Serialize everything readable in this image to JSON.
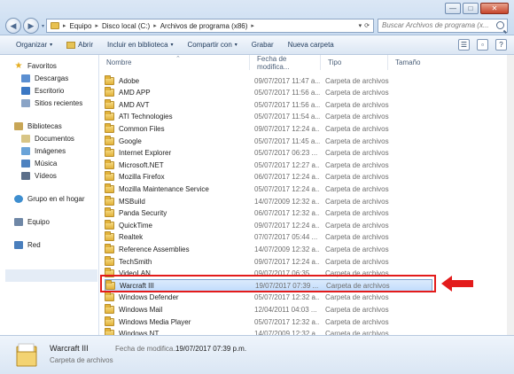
{
  "window": {
    "minimize_glyph": "—",
    "maximize_glyph": "□",
    "close_glyph": "✕"
  },
  "address": {
    "crumbs": [
      "Equipo",
      "Disco local (C:)",
      "Archivos de programa (x86)"
    ],
    "separator": "▸",
    "dropdown_glyph": "▾",
    "refresh_glyph": "⟳"
  },
  "search": {
    "placeholder": "Buscar Archivos de programa (x..."
  },
  "toolbar": {
    "organize": "Organizar",
    "open": "Abrir",
    "include": "Incluir en biblioteca",
    "share": "Compartir con",
    "burn": "Grabar",
    "new_folder": "Nueva carpeta",
    "caret": "▾"
  },
  "navpane": {
    "favorites": "Favoritos",
    "downloads": "Descargas",
    "desktop": "Escritorio",
    "recent": "Sitios recientes",
    "libraries": "Bibliotecas",
    "documents": "Documentos",
    "images": "Imágenes",
    "music": "Música",
    "videos": "Vídeos",
    "homegroup": "Grupo en el hogar",
    "computer": "Equipo",
    "network": "Red"
  },
  "columns": {
    "name": "Nombre",
    "date": "Fecha de modifica...",
    "type": "Tipo",
    "size": "Tamaño"
  },
  "files": [
    {
      "name": "Adobe",
      "date": "09/07/2017 11:47 a...",
      "type": "Carpeta de archivos"
    },
    {
      "name": "AMD APP",
      "date": "05/07/2017 11:56 a...",
      "type": "Carpeta de archivos"
    },
    {
      "name": "AMD AVT",
      "date": "05/07/2017 11:56 a...",
      "type": "Carpeta de archivos"
    },
    {
      "name": "ATI Technologies",
      "date": "05/07/2017 11:54 a...",
      "type": "Carpeta de archivos"
    },
    {
      "name": "Common Files",
      "date": "09/07/2017 12:24 a...",
      "type": "Carpeta de archivos"
    },
    {
      "name": "Google",
      "date": "05/07/2017 11:45 a...",
      "type": "Carpeta de archivos"
    },
    {
      "name": "Internet Explorer",
      "date": "05/07/2017 06:23 ...",
      "type": "Carpeta de archivos"
    },
    {
      "name": "Microsoft.NET",
      "date": "05/07/2017 12:27 a...",
      "type": "Carpeta de archivos"
    },
    {
      "name": "Mozilla Firefox",
      "date": "06/07/2017 12:24 a...",
      "type": "Carpeta de archivos"
    },
    {
      "name": "Mozilla Maintenance Service",
      "date": "05/07/2017 12:24 a...",
      "type": "Carpeta de archivos"
    },
    {
      "name": "MSBuild",
      "date": "14/07/2009 12:32 a...",
      "type": "Carpeta de archivos"
    },
    {
      "name": "Panda Security",
      "date": "06/07/2017 12:32 a...",
      "type": "Carpeta de archivos"
    },
    {
      "name": "QuickTime",
      "date": "09/07/2017 12:24 a...",
      "type": "Carpeta de archivos"
    },
    {
      "name": "Realtek",
      "date": "07/07/2017 05:44 ...",
      "type": "Carpeta de archivos"
    },
    {
      "name": "Reference Assemblies",
      "date": "14/07/2009 12:32 a...",
      "type": "Carpeta de archivos"
    },
    {
      "name": "TechSmith",
      "date": "09/07/2017 12:24 a...",
      "type": "Carpeta de archivos"
    },
    {
      "name": "VideoLAN",
      "date": "09/07/2017 06:35 ...",
      "type": "Carpeta de archivos"
    },
    {
      "name": "Warcraft III",
      "date": "19/07/2017 07:39 ...",
      "type": "Carpeta de archivos"
    },
    {
      "name": "Windows Defender",
      "date": "05/07/2017 12:32 a...",
      "type": "Carpeta de archivos"
    },
    {
      "name": "Windows Mail",
      "date": "12/04/2011 04:03 ...",
      "type": "Carpeta de archivos"
    },
    {
      "name": "Windows Media Player",
      "date": "05/07/2017 12:32 a...",
      "type": "Carpeta de archivos"
    },
    {
      "name": "Windows NT",
      "date": "14/07/2009 12:32 a...",
      "type": "Carpeta de archivos"
    }
  ],
  "selected_index": 17,
  "details": {
    "name": "Warcraft III",
    "type": "Carpeta de archivos",
    "date_label": "Fecha de modifica...",
    "date_value": "19/07/2017 07:39 p.m."
  },
  "colors": {
    "highlight_border": "#e31b1b",
    "arrow": "#e31b1b",
    "selection": "#c1dcfc"
  },
  "icons": [
    "back-icon",
    "forward-icon",
    "folder-icon",
    "search-icon",
    "star-icon",
    "library-icon",
    "homegroup-icon",
    "computer-icon",
    "network-icon",
    "view-options-icon",
    "preview-pane-icon",
    "help-icon"
  ]
}
